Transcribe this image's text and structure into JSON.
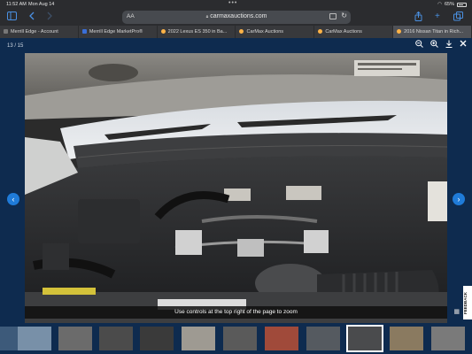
{
  "status_bar": {
    "time": "11:52 AM",
    "date": "Mon Aug 14",
    "battery": "65%",
    "signal_icon": "wifi-icon",
    "battery_icon": "battery-icon"
  },
  "toolbar": {
    "text_size_label": "AA",
    "url": "carmaxauctions.com",
    "icons": [
      "sidebar-icon",
      "back-icon",
      "forward-icon",
      "share-icon",
      "new-tab-icon",
      "tabs-icon"
    ]
  },
  "tabs": [
    {
      "label": "Merrill Edge - Account",
      "favicon": "grey"
    },
    {
      "label": "Merrill Edge MarketPro®",
      "favicon": "grey"
    },
    {
      "label": "2022 Lexus ES 350 in Ba...",
      "favicon": "carmax"
    },
    {
      "label": "CarMax Auctions",
      "favicon": "carmax"
    },
    {
      "label": "CarMax Auctions",
      "favicon": "carmax"
    },
    {
      "label": "2016 Nissan Titan in Rich...",
      "favicon": "carmax",
      "active": true
    }
  ],
  "viewer": {
    "counter": "13 / 15",
    "hint": "Use controls at the top right of the page to zoom",
    "feedback_label": "FEEDBACK",
    "tools": [
      "zoom-out-icon",
      "zoom-in-icon",
      "download-icon",
      "close-icon"
    ]
  },
  "thumbnails": {
    "count": 14,
    "selected_index": 8
  }
}
